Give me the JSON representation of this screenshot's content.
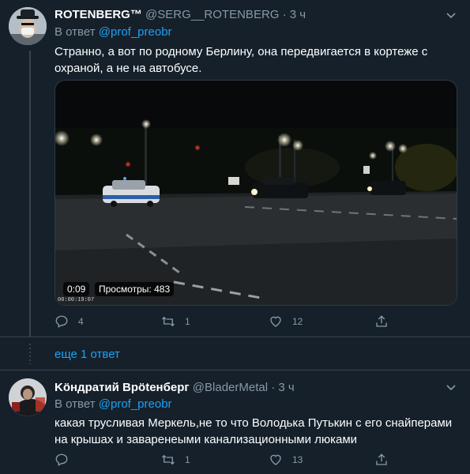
{
  "colors": {
    "background": "#15202b",
    "link": "#1da1f2",
    "muted": "#8899a6",
    "divider": "#38444d"
  },
  "tweets": [
    {
      "name": "ROTENBERG™",
      "handle": "@SERG__ROTENBERG",
      "separator": "·",
      "time": "3 ч",
      "reply_prefix": "В ответ",
      "reply_to": "@prof_preobr",
      "text": "Странно, а вот по родному Берлину, она передвигается в кортеже с охраной, а не на автобусе.",
      "video": {
        "duration": "0:09",
        "views": "Просмотры: 483",
        "timestamp_overlay": "00:00:19:07"
      },
      "actions": {
        "reply": "4",
        "retweet": "1",
        "like": "12",
        "share": ""
      }
    },
    {
      "name": "Köндратий Врötенберг",
      "handle": "@BladerMetal",
      "separator": "·",
      "time": "3 ч",
      "reply_prefix": "В ответ",
      "reply_to": "@prof_preobr",
      "text": "какая трусливая Меркель,не то что Володька Путькин с его снайперами на крышах и заваренеыми канализационными люками",
      "actions": {
        "reply": "",
        "retweet": "1",
        "like": "13",
        "share": ""
      }
    }
  ],
  "more_replies": "еще 1 ответ"
}
